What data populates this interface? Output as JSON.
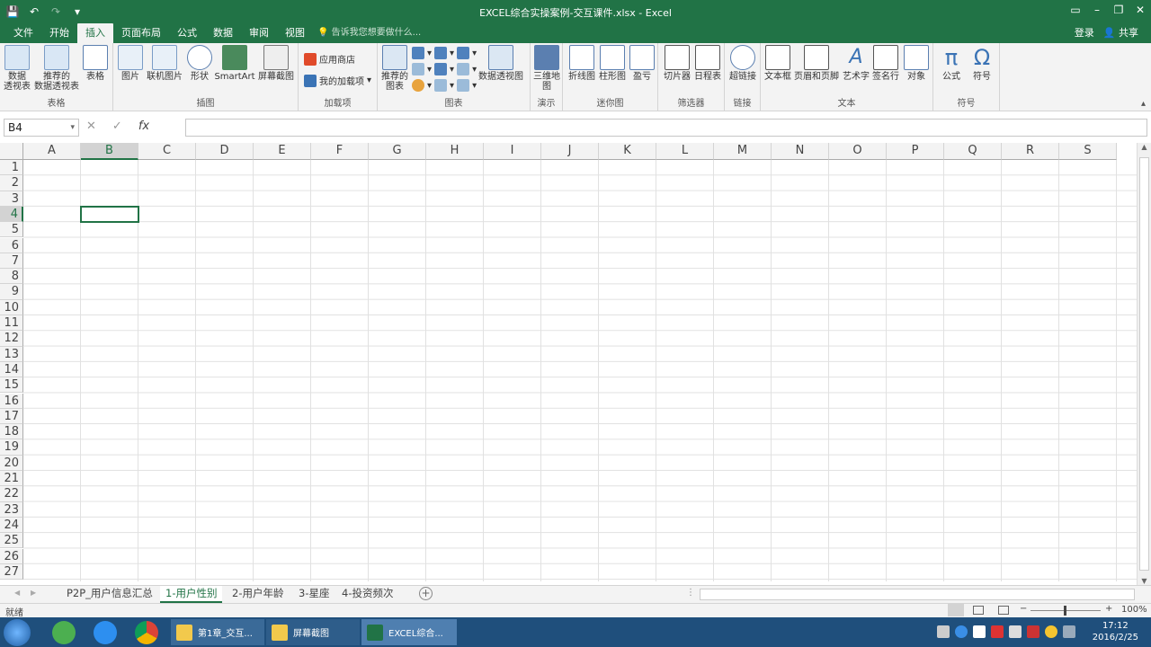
{
  "window": {
    "title": "EXCEL综合实操案例-交互课件.xlsx - Excel"
  },
  "qat": {
    "save": "💾",
    "undo": "↶",
    "redo": "↷",
    "more": "▾"
  },
  "ribbon_tabs": [
    "文件",
    "开始",
    "插入",
    "页面布局",
    "公式",
    "数据",
    "审阅",
    "视图"
  ],
  "active_tab": "插入",
  "tell_me": "告诉我您想要做什么...",
  "account": {
    "login": "登录",
    "share": "共享"
  },
  "groups": {
    "tables": {
      "label": "表格",
      "items": [
        "数据\n透视表",
        "推荐的\n数据透视表",
        "表格"
      ]
    },
    "illustrations": {
      "label": "插图",
      "items": [
        "图片",
        "联机图片",
        "形状",
        "SmartArt",
        "屏幕截图"
      ]
    },
    "addins": {
      "label": "加载项",
      "store": "应用商店",
      "my_addins": "我的加载项"
    },
    "charts": {
      "label": "图表",
      "recommended": "推荐的\n图表",
      "pivotchart": "数据透视图"
    },
    "tours": {
      "label": "演示",
      "map3d": "三维地\n图"
    },
    "sparklines": {
      "label": "迷你图",
      "items": [
        "折线图",
        "柱形图",
        "盈亏"
      ]
    },
    "filters": {
      "label": "筛选器",
      "items": [
        "切片器",
        "日程表"
      ]
    },
    "links": {
      "label": "链接",
      "items": [
        "超链接"
      ]
    },
    "text": {
      "label": "文本",
      "items": [
        "文本框",
        "页眉和页脚",
        "艺术字",
        "签名行",
        "对象"
      ]
    },
    "symbols": {
      "label": "符号",
      "items": [
        "公式",
        "符号"
      ]
    }
  },
  "formula": {
    "namebox": "B4",
    "cancel": "✕",
    "enter": "✓",
    "fx": "fx",
    "value": ""
  },
  "columns": [
    "A",
    "B",
    "C",
    "D",
    "E",
    "F",
    "G",
    "H",
    "I",
    "J",
    "K",
    "L",
    "M",
    "N",
    "O",
    "P",
    "Q",
    "R",
    "S"
  ],
  "rows": [
    "1",
    "2",
    "3",
    "4",
    "5",
    "6",
    "7",
    "8",
    "9",
    "10",
    "11",
    "12",
    "13",
    "14",
    "15",
    "16",
    "17",
    "18",
    "19",
    "20",
    "21",
    "22",
    "23",
    "24",
    "25",
    "26",
    "27"
  ],
  "selected": {
    "col": "B",
    "row": "4"
  },
  "sheets": [
    "P2P_用户信息汇总",
    "1-用户性别",
    "2-用户年龄",
    "3-星座",
    "4-投资频次"
  ],
  "active_sheet": "1-用户性别",
  "status": {
    "ready": "就绪",
    "zoom": "100%"
  },
  "taskbar": {
    "items": [
      "第1章_交互...",
      "屏幕截图",
      "EXCEL综合..."
    ],
    "time": "17:12",
    "date": "2016/2/25"
  },
  "colors": {
    "accent": "#217346",
    "taskbar": "#1f4f7c"
  }
}
